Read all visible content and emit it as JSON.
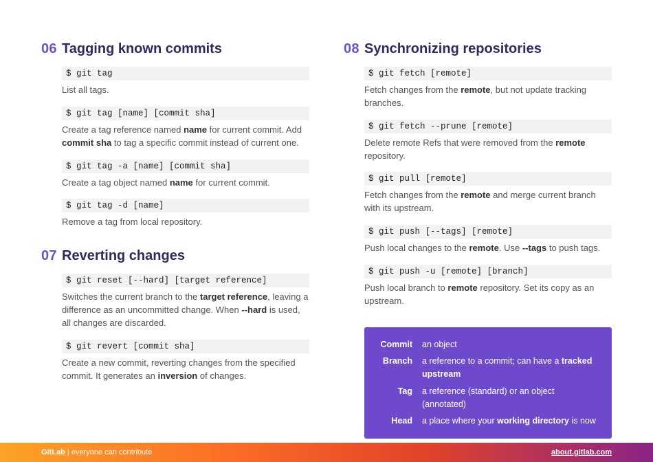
{
  "sections": [
    {
      "num": "06",
      "title": "Tagging known commits",
      "entries": [
        {
          "cmd": "$ git tag",
          "desc": "List all tags."
        },
        {
          "cmd": "$ git tag [name] [commit sha]",
          "desc": "Create a tag reference named <b>name</b> for current commit. Add <b>commit sha</b> to tag a specific commit instead of current one."
        },
        {
          "cmd": "$ git tag -a [name] [commit sha]",
          "desc": "Create a tag object named <b>name</b> for current commit."
        },
        {
          "cmd": "$ git tag -d [name]",
          "desc": "Remove a tag from local repository."
        }
      ]
    },
    {
      "num": "07",
      "title": "Reverting changes",
      "entries": [
        {
          "cmd": "$ git reset [--hard] [target reference]",
          "desc": "Switches the current branch to the <b>target reference</b>, leaving a difference as an uncommitted change. When <b>--hard</b> is used, all changes are discarded."
        },
        {
          "cmd": "$ git revert [commit sha]",
          "desc": "Create a new commit, reverting changes from the specified commit. It generates an <b>inversion</b> of changes."
        }
      ]
    },
    {
      "num": "08",
      "title": "Synchronizing repositories",
      "entries": [
        {
          "cmd": "$ git fetch [remote]",
          "desc": "Fetch changes from the <b>remote</b>, but not update tracking branches."
        },
        {
          "cmd": "$ git fetch --prune [remote]",
          "desc": "Delete remote Refs that were removed from the <b>remote</b> repository."
        },
        {
          "cmd": "$ git pull [remote]",
          "desc": "Fetch changes from the <b>remote</b> and merge current branch with its upstream."
        },
        {
          "cmd": "$ git push [--tags] [remote]",
          "desc": "Push local changes to the <b>remote</b>. Use <b>--tags</b> to push tags."
        },
        {
          "cmd": "$ git push -u [remote] [branch]",
          "desc": "Push local branch to <b>remote</b> repository. Set its copy as an upstream."
        }
      ]
    }
  ],
  "glossary": [
    {
      "term": "Commit",
      "def": "an object"
    },
    {
      "term": "Branch",
      "def": "a reference to a commit; can have a <b>tracked upstream</b>"
    },
    {
      "term": "Tag",
      "def": "a reference (standard) or an object (annotated)"
    },
    {
      "term": "Head",
      "def": "a place where your <b>working directory</b> is now"
    }
  ],
  "footer": {
    "brand": "GitLab",
    "tagline": " | everyone can contribute",
    "link": "about.gitlab.com"
  }
}
